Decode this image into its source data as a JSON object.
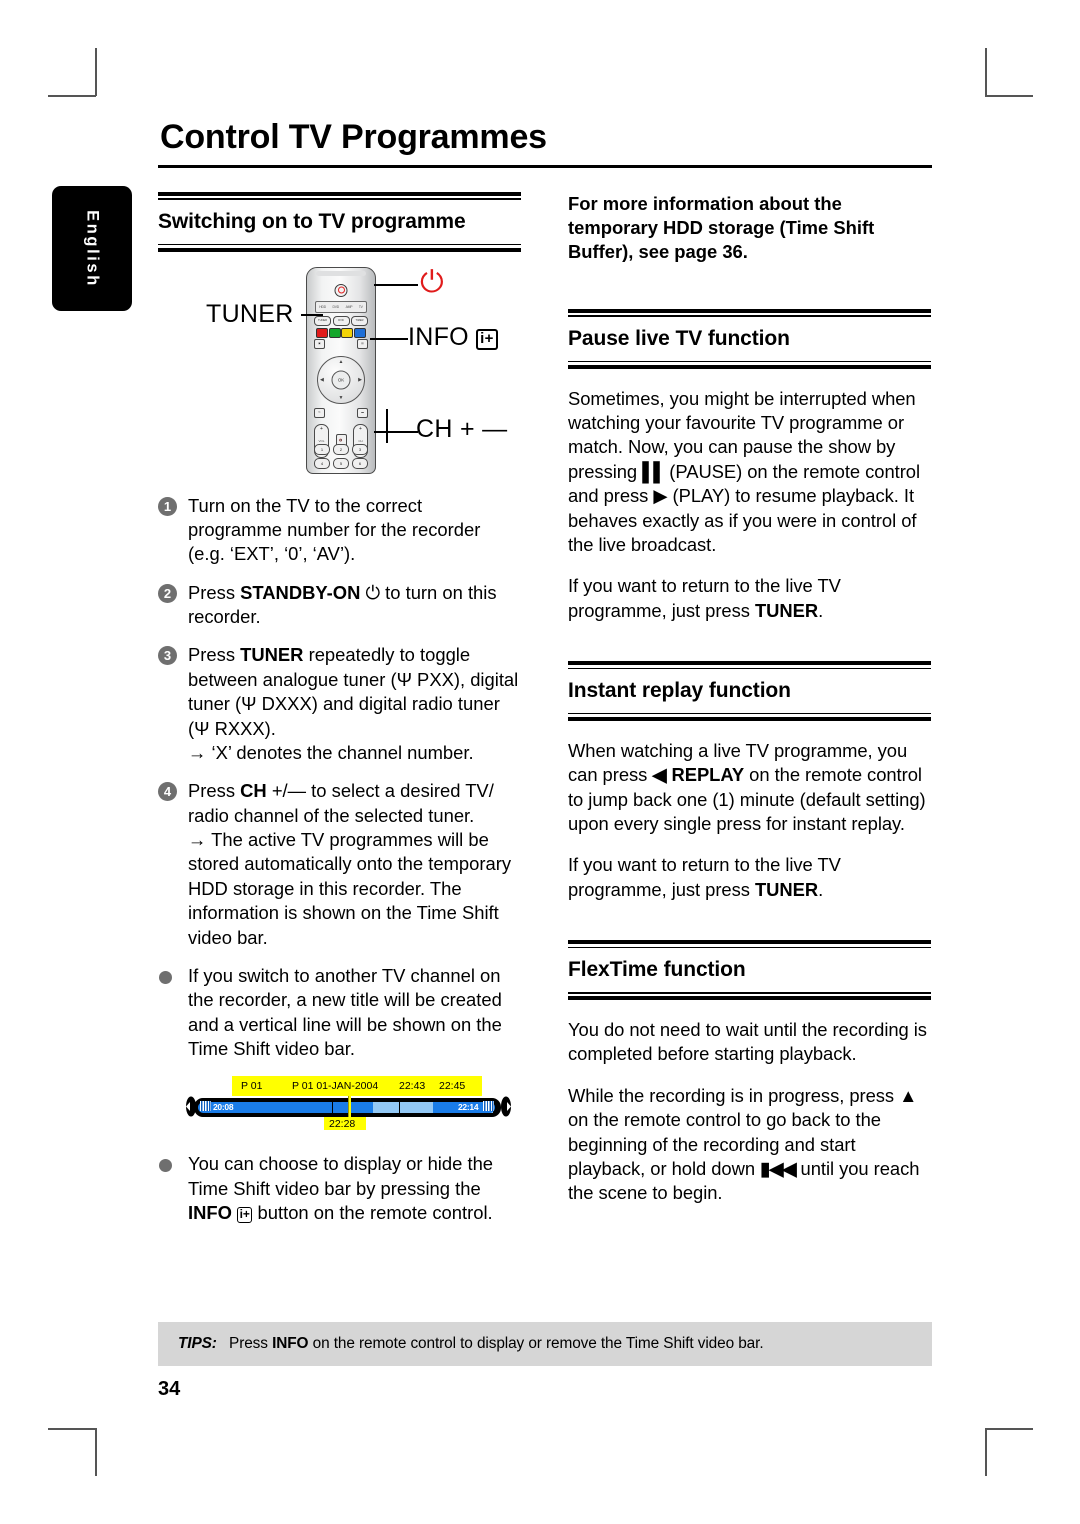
{
  "page": {
    "title": "Control TV Programmes",
    "language_tab": "English",
    "page_number": "34"
  },
  "left_column": {
    "heading": "Switching on to TV programme",
    "remote_figure": {
      "callouts": [
        {
          "name": "tuner",
          "label": "TUNER"
        },
        {
          "name": "standby",
          "label": "",
          "icon": "power-icon"
        },
        {
          "name": "info",
          "label": "INFO",
          "icon": "info-plus-icon"
        },
        {
          "name": "channel",
          "label": "CH",
          "plus": "+",
          "minus": "—"
        }
      ],
      "lcd_labels": [
        "HDD",
        "DVD",
        "AMP",
        "TV"
      ],
      "key_labels": [
        "TUNER",
        "DVD",
        "TIMER"
      ],
      "ok_label": "OK",
      "numpad": [
        "1",
        "2",
        "3",
        "4",
        "5",
        "6"
      ]
    },
    "steps": [
      {
        "num": "1",
        "text": "Turn on the TV to the correct programme number for the recorder (e.g. ‘EXT’, ‘0’, ‘AV’)."
      },
      {
        "num": "2",
        "prefix": "Press ",
        "bold": "STANDBY-ON",
        "icon": "power-outline-icon",
        "suffix": " to turn on this recorder."
      },
      {
        "num": "3",
        "prefix": "Press ",
        "bold": "TUNER",
        "suffix": " repeatedly to toggle between analogue tuner (Ψ PXX), digital tuner (Ψ DXXX) and digital radio tuner (Ψ RXXX).",
        "sub": "‘X’ denotes the channel number."
      },
      {
        "num": "4",
        "prefix": "Press ",
        "bold": "CH",
        "keys": "+/—",
        "suffix": " to select a desired TV/ radio channel of the selected tuner.",
        "sub": "The active TV programmes will be stored automatically onto the temporary HDD storage in this recorder. The information is shown on the Time Shift video bar."
      }
    ],
    "bullets": [
      {
        "text": "If you switch to another TV channel on the recorder, a new title will be created and a vertical line will be shown on the Time Shift video bar."
      },
      {
        "prefix": "You can choose to display or hide the Time Shift video bar by pressing the ",
        "bold": "INFO",
        "icon": "info-plus-icon",
        "suffix": " button on the remote control."
      }
    ],
    "timeshift_bar": {
      "labels_top": [
        "P 01",
        "P 01 01-JAN-2004",
        "22:43",
        "22:45"
      ],
      "label_bottom": "22:28",
      "time_start": "20:08",
      "time_end": "22:14"
    }
  },
  "right_column": {
    "intro_note": "For more information about the temporary HDD storage (Time Shift Buffer), see page 36.",
    "sections": [
      {
        "heading": "Pause live TV function",
        "paragraphs": [
          {
            "parts": [
              {
                "t": "Sometimes, you might be interrupted when watching your favourite TV programme or match. Now, you can pause the show by pressing "
              },
              {
                "t": "▐▌",
                "icon": "pause-icon"
              },
              {
                "t": " (PAUSE) on the remote control and press "
              },
              {
                "t": "▶",
                "icon": "play-icon"
              },
              {
                "t": " (PLAY) to resume playback. It behaves exactly as if you were in control of the live broadcast."
              }
            ]
          },
          {
            "parts": [
              {
                "t": "If you want to return to the live TV programme, just press "
              },
              {
                "t": "TUNER",
                "bold": true
              },
              {
                "t": "."
              }
            ]
          }
        ]
      },
      {
        "heading": "Instant replay function",
        "paragraphs": [
          {
            "parts": [
              {
                "t": "When watching a live TV programme, you can press "
              },
              {
                "t": "◀",
                "icon": "replay-icon"
              },
              {
                "t": " REPLAY",
                "bold": true
              },
              {
                "t": " on the remote control to jump back one (1) minute (default setting) upon every single press for instant replay."
              }
            ]
          },
          {
            "parts": [
              {
                "t": "If you want to return to the live TV programme, just press "
              },
              {
                "t": "TUNER",
                "bold": true
              },
              {
                "t": "."
              }
            ]
          }
        ]
      },
      {
        "heading": "FlexTime function",
        "paragraphs": [
          {
            "parts": [
              {
                "t": "You do not need to wait until the recording is completed before starting playback."
              }
            ]
          },
          {
            "parts": [
              {
                "t": "While the recording is in progress, press "
              },
              {
                "t": "▲",
                "icon": "up-arrow-icon"
              },
              {
                "t": " on the remote control to go back to the beginning of the recording and start playback, or hold down "
              },
              {
                "t": "⏮◀",
                "icon": "previous-icon"
              },
              {
                "t": " until you reach the scene to begin."
              }
            ]
          }
        ]
      }
    ]
  },
  "tips": {
    "label": "TIPS:",
    "prefix": "Press ",
    "bold": "INFO",
    "suffix": " on the remote control to display or remove the Time Shift video bar."
  },
  "colors": {
    "accent_red": "#e01b1b",
    "badge_grey": "#6f6f6f",
    "tips_bg": "#d6d6d6",
    "bar_yellow": "#ffff00",
    "bar_blue_dark": "#1a7ce8",
    "bar_blue_light": "#93c8f5"
  }
}
